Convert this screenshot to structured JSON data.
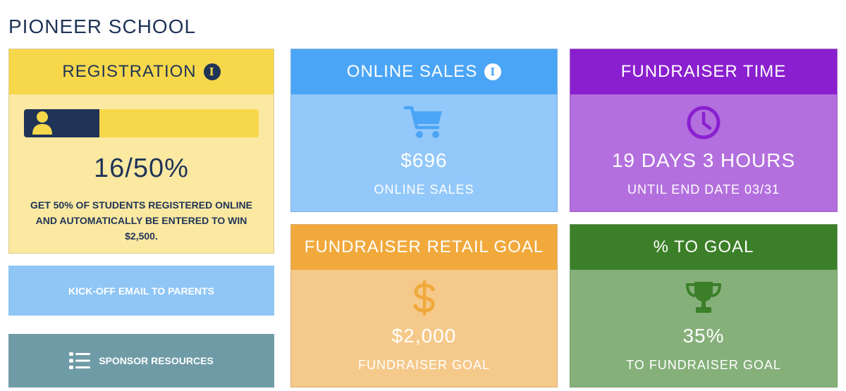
{
  "school": {
    "name": "PIONEER SCHOOL"
  },
  "registration": {
    "title": "REGISTRATION",
    "value": "16/50%",
    "progress_fraction": 0.32,
    "description": "GET 50% OF STUDENTS REGISTERED ONLINE AND AUTOMATICALLY BE ENTERED TO WIN $2,500.",
    "info_icon": "info-icon",
    "progress_icon": "person-icon"
  },
  "actions": {
    "kickoff_label": "KICK-OFF EMAIL TO PARENTS",
    "sponsor_label": "SPONSOR RESOURCES",
    "sponsor_icon": "list-icon"
  },
  "online_sales": {
    "title": "ONLINE SALES",
    "value": "$696",
    "label": "ONLINE SALES",
    "icon": "cart-icon",
    "info_icon": "info-icon"
  },
  "fundraiser_time": {
    "title": "FUNDRAISER TIME",
    "value": "19 DAYS 3 HOURS",
    "label": "UNTIL END DATE 03/31",
    "icon": "clock-icon"
  },
  "retail_goal": {
    "title": "FUNDRAISER RETAIL GOAL",
    "value": "$2,000",
    "label": "FUNDRAISER GOAL",
    "icon": "dollar-icon"
  },
  "percent_goal": {
    "title": "% TO GOAL",
    "value": "35%",
    "label": "TO FUNDRAISER GOAL",
    "icon": "trophy-icon"
  },
  "colors": {
    "navy": "#1f3457",
    "registration_header": "#f7d84b",
    "online_header": "#4ba5f6",
    "time_header": "#8a1fcf",
    "retail_header": "#f1a93c",
    "goal_header": "#3b7f28"
  }
}
